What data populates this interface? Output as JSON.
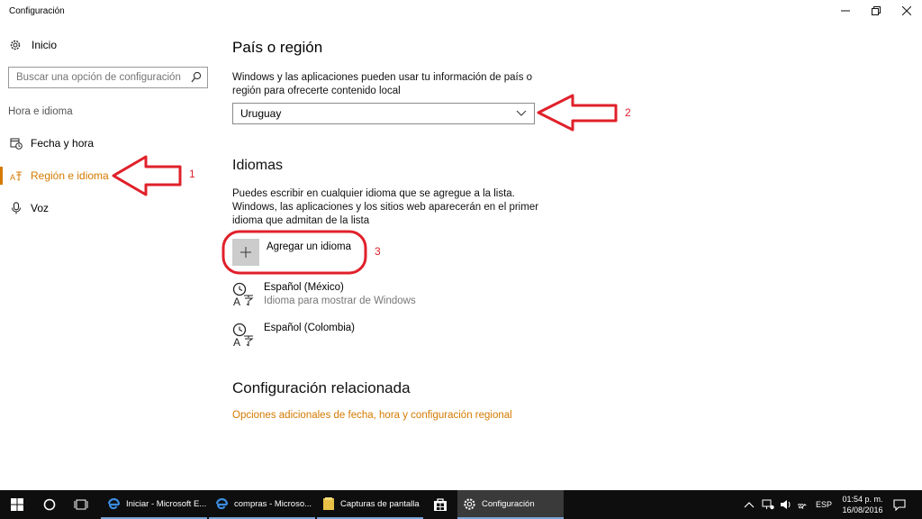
{
  "window": {
    "title": "Configuración"
  },
  "sidebar": {
    "home_label": "Inicio",
    "search_placeholder": "Buscar una opción de configuración",
    "group_label": "Hora e idioma",
    "items": [
      {
        "label": "Fecha y hora",
        "icon": "calendar-clock-icon"
      },
      {
        "label": "Región e idioma",
        "icon": "region-language-icon",
        "active": true
      },
      {
        "label": "Voz",
        "icon": "microphone-icon"
      }
    ]
  },
  "main": {
    "country": {
      "heading": "País o región",
      "description_line1": "Windows y las aplicaciones pueden usar tu información de país o",
      "description_line2": "región para ofrecerte contenido local",
      "selected": "Uruguay"
    },
    "languages": {
      "heading": "Idiomas",
      "description_line1": "Puedes escribir en cualquier idioma que se agregue a la lista.",
      "description_line2": "Windows, las aplicaciones y los sitios web aparecerán en el primer",
      "description_line3": "idioma que admitan de la lista",
      "add_label": "Agregar un idioma",
      "list": [
        {
          "name": "Español (México)",
          "sub": "Idioma para mostrar de Windows"
        },
        {
          "name": "Español (Colombia)",
          "sub": ""
        }
      ]
    },
    "related": {
      "heading": "Configuración relacionada",
      "link": "Opciones adicionales de fecha, hora y configuración regional"
    }
  },
  "annotations": {
    "n1": "1",
    "n2": "2",
    "n3": "3",
    "color": "#e0202a"
  },
  "taskbar": {
    "tasks": [
      {
        "label": "Iniciar - Microsoft E...",
        "icon": "edge-icon"
      },
      {
        "label": "compras - Microso...",
        "icon": "edge-icon"
      },
      {
        "label": "Capturas de pantalla",
        "icon": "folder-icon"
      },
      {
        "label": "",
        "icon": "store-icon"
      },
      {
        "label": "Configuración",
        "icon": "gear-icon",
        "active": true
      }
    ],
    "language": "ESP",
    "time": "01:54 p. m.",
    "date": "16/08/2016"
  },
  "colors": {
    "accent": "#d47a00",
    "taskbar": "#0e0e0e"
  }
}
